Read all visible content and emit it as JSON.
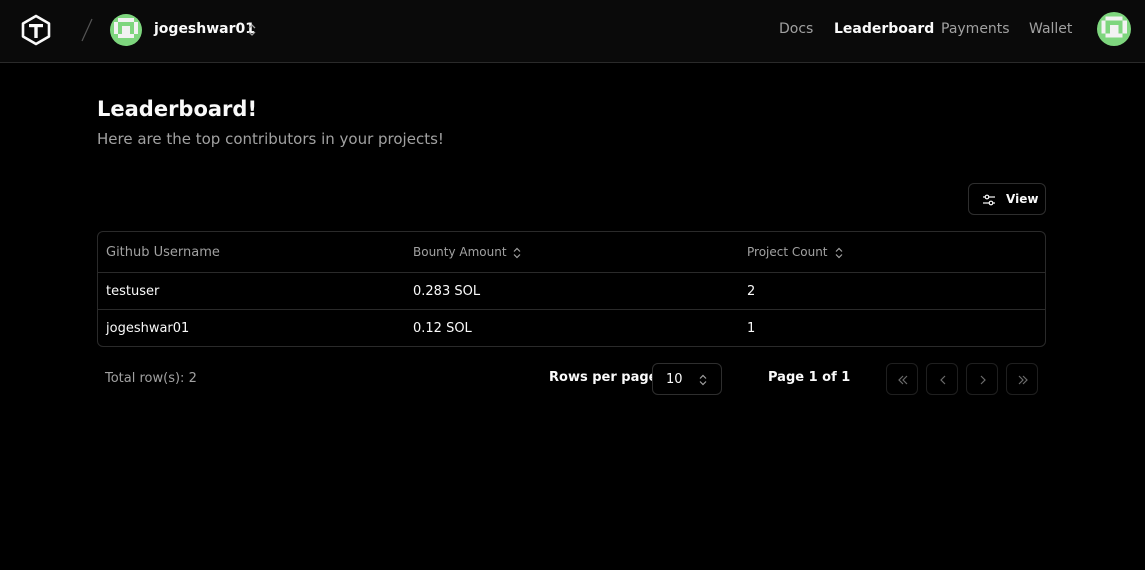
{
  "header": {
    "logo_icon": "hexagon-t-logo-icon",
    "username": "jogeshwar01",
    "nav": [
      {
        "label": "Docs",
        "active": false
      },
      {
        "label": "Leaderboard",
        "active": true
      },
      {
        "label": "Payments",
        "active": false
      },
      {
        "label": "Wallet",
        "active": false
      }
    ]
  },
  "page": {
    "title": "Leaderboard!",
    "subtitle": "Here are the top contributors in your projects!"
  },
  "toolbar": {
    "view_label": "View",
    "view_icon": "sliders-icon"
  },
  "table": {
    "columns": [
      "Github Username",
      "Bounty Amount",
      "Project Count"
    ],
    "rows": [
      [
        "testuser",
        "0.283 SOL",
        "2"
      ],
      [
        "jogeshwar01",
        "0.12 SOL",
        "1"
      ]
    ]
  },
  "footer": {
    "total_rows": "Total row(s): 2",
    "rows_per_page_label": "Rows per page",
    "rows_per_page_value": "10",
    "page_info": "Page 1 of 1"
  },
  "colors": {
    "background": "#000000",
    "text": "#fafafa",
    "muted": "#a1a1a1",
    "border": "#2a2a2a",
    "avatar_green": "#7ed67e"
  }
}
